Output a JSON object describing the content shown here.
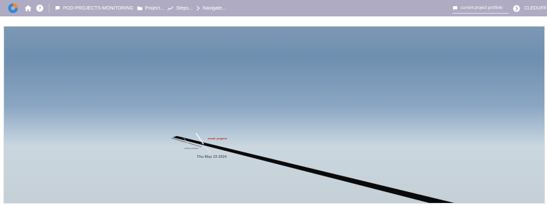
{
  "topbar": {
    "logo_icon": "app-logo-icon",
    "home_icon": "home-icon",
    "help_icon": "help-icon",
    "breadcrumbs": [
      {
        "label": "POD-PROJECTS-MONITORING",
        "icon": "chat-icon"
      },
      {
        "label": "Project...",
        "icon": "folder-icon"
      },
      {
        "label": "Steps...",
        "icon": "trend-icon"
      },
      {
        "label": "Navigate...",
        "icon": "chevron-right-icon"
      }
    ],
    "portfolio_label": "current project portfolio",
    "user_name": "CLEDUFF"
  },
  "scene": {
    "progress_label": "overall_progress",
    "small_label": "scaling window",
    "date_label": "Thu May 23 2024"
  },
  "colors": {
    "topbar": "#aeabc3",
    "sky_top": "#6f8fb0",
    "horizon": "#cbd7df",
    "progress_label": "#d0262b"
  }
}
